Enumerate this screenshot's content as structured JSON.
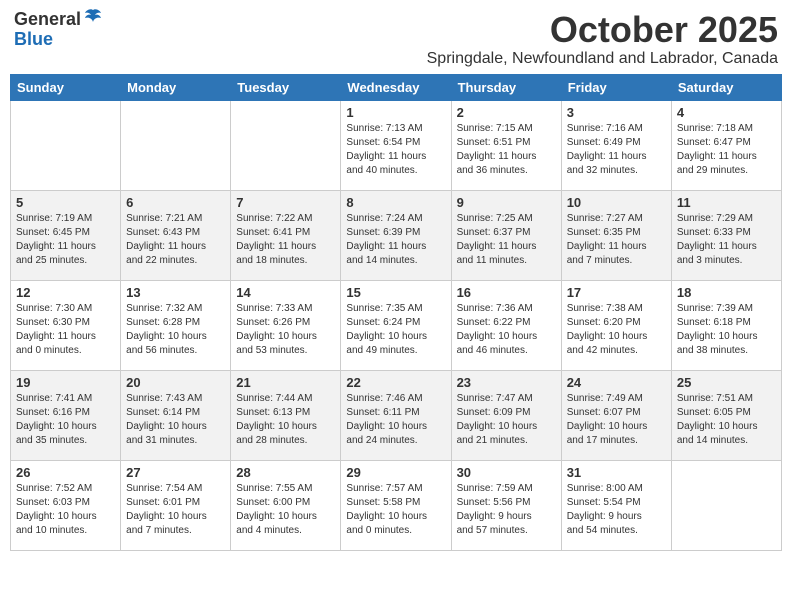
{
  "header": {
    "logo_general": "General",
    "logo_blue": "Blue",
    "month": "October 2025",
    "location": "Springdale, Newfoundland and Labrador, Canada"
  },
  "weekdays": [
    "Sunday",
    "Monday",
    "Tuesday",
    "Wednesday",
    "Thursday",
    "Friday",
    "Saturday"
  ],
  "weeks": [
    [
      {
        "day": "",
        "info": ""
      },
      {
        "day": "",
        "info": ""
      },
      {
        "day": "",
        "info": ""
      },
      {
        "day": "1",
        "info": "Sunrise: 7:13 AM\nSunset: 6:54 PM\nDaylight: 11 hours\nand 40 minutes."
      },
      {
        "day": "2",
        "info": "Sunrise: 7:15 AM\nSunset: 6:51 PM\nDaylight: 11 hours\nand 36 minutes."
      },
      {
        "day": "3",
        "info": "Sunrise: 7:16 AM\nSunset: 6:49 PM\nDaylight: 11 hours\nand 32 minutes."
      },
      {
        "day": "4",
        "info": "Sunrise: 7:18 AM\nSunset: 6:47 PM\nDaylight: 11 hours\nand 29 minutes."
      }
    ],
    [
      {
        "day": "5",
        "info": "Sunrise: 7:19 AM\nSunset: 6:45 PM\nDaylight: 11 hours\nand 25 minutes."
      },
      {
        "day": "6",
        "info": "Sunrise: 7:21 AM\nSunset: 6:43 PM\nDaylight: 11 hours\nand 22 minutes."
      },
      {
        "day": "7",
        "info": "Sunrise: 7:22 AM\nSunset: 6:41 PM\nDaylight: 11 hours\nand 18 minutes."
      },
      {
        "day": "8",
        "info": "Sunrise: 7:24 AM\nSunset: 6:39 PM\nDaylight: 11 hours\nand 14 minutes."
      },
      {
        "day": "9",
        "info": "Sunrise: 7:25 AM\nSunset: 6:37 PM\nDaylight: 11 hours\nand 11 minutes."
      },
      {
        "day": "10",
        "info": "Sunrise: 7:27 AM\nSunset: 6:35 PM\nDaylight: 11 hours\nand 7 minutes."
      },
      {
        "day": "11",
        "info": "Sunrise: 7:29 AM\nSunset: 6:33 PM\nDaylight: 11 hours\nand 3 minutes."
      }
    ],
    [
      {
        "day": "12",
        "info": "Sunrise: 7:30 AM\nSunset: 6:30 PM\nDaylight: 11 hours\nand 0 minutes."
      },
      {
        "day": "13",
        "info": "Sunrise: 7:32 AM\nSunset: 6:28 PM\nDaylight: 10 hours\nand 56 minutes."
      },
      {
        "day": "14",
        "info": "Sunrise: 7:33 AM\nSunset: 6:26 PM\nDaylight: 10 hours\nand 53 minutes."
      },
      {
        "day": "15",
        "info": "Sunrise: 7:35 AM\nSunset: 6:24 PM\nDaylight: 10 hours\nand 49 minutes."
      },
      {
        "day": "16",
        "info": "Sunrise: 7:36 AM\nSunset: 6:22 PM\nDaylight: 10 hours\nand 46 minutes."
      },
      {
        "day": "17",
        "info": "Sunrise: 7:38 AM\nSunset: 6:20 PM\nDaylight: 10 hours\nand 42 minutes."
      },
      {
        "day": "18",
        "info": "Sunrise: 7:39 AM\nSunset: 6:18 PM\nDaylight: 10 hours\nand 38 minutes."
      }
    ],
    [
      {
        "day": "19",
        "info": "Sunrise: 7:41 AM\nSunset: 6:16 PM\nDaylight: 10 hours\nand 35 minutes."
      },
      {
        "day": "20",
        "info": "Sunrise: 7:43 AM\nSunset: 6:14 PM\nDaylight: 10 hours\nand 31 minutes."
      },
      {
        "day": "21",
        "info": "Sunrise: 7:44 AM\nSunset: 6:13 PM\nDaylight: 10 hours\nand 28 minutes."
      },
      {
        "day": "22",
        "info": "Sunrise: 7:46 AM\nSunset: 6:11 PM\nDaylight: 10 hours\nand 24 minutes."
      },
      {
        "day": "23",
        "info": "Sunrise: 7:47 AM\nSunset: 6:09 PM\nDaylight: 10 hours\nand 21 minutes."
      },
      {
        "day": "24",
        "info": "Sunrise: 7:49 AM\nSunset: 6:07 PM\nDaylight: 10 hours\nand 17 minutes."
      },
      {
        "day": "25",
        "info": "Sunrise: 7:51 AM\nSunset: 6:05 PM\nDaylight: 10 hours\nand 14 minutes."
      }
    ],
    [
      {
        "day": "26",
        "info": "Sunrise: 7:52 AM\nSunset: 6:03 PM\nDaylight: 10 hours\nand 10 minutes."
      },
      {
        "day": "27",
        "info": "Sunrise: 7:54 AM\nSunset: 6:01 PM\nDaylight: 10 hours\nand 7 minutes."
      },
      {
        "day": "28",
        "info": "Sunrise: 7:55 AM\nSunset: 6:00 PM\nDaylight: 10 hours\nand 4 minutes."
      },
      {
        "day": "29",
        "info": "Sunrise: 7:57 AM\nSunset: 5:58 PM\nDaylight: 10 hours\nand 0 minutes."
      },
      {
        "day": "30",
        "info": "Sunrise: 7:59 AM\nSunset: 5:56 PM\nDaylight: 9 hours\nand 57 minutes."
      },
      {
        "day": "31",
        "info": "Sunrise: 8:00 AM\nSunset: 5:54 PM\nDaylight: 9 hours\nand 54 minutes."
      },
      {
        "day": "",
        "info": ""
      }
    ]
  ]
}
